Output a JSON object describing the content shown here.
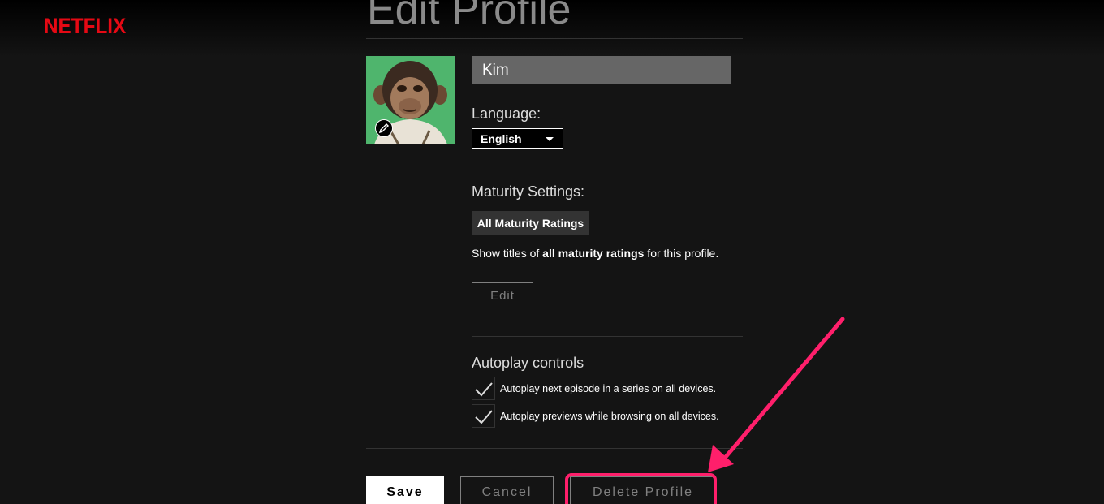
{
  "brand": {
    "logo_text": "NETFLIX",
    "logo_color": "#e50914"
  },
  "page": {
    "title": "Edit Profile"
  },
  "profile": {
    "name_value": "Kim",
    "avatar_icon": "chimpanzee-avatar",
    "edit_icon": "pencil-icon"
  },
  "language": {
    "label": "Language:",
    "selected": "English"
  },
  "maturity": {
    "label": "Maturity Settings:",
    "badge": "All Maturity Ratings",
    "desc_prefix": "Show titles of ",
    "desc_bold": "all maturity ratings",
    "desc_suffix": " for this profile.",
    "edit_label": "Edit"
  },
  "autoplay": {
    "label": "Autoplay controls",
    "options": [
      {
        "label": "Autoplay next episode in a series on all devices.",
        "checked": true
      },
      {
        "label": "Autoplay previews while browsing on all devices.",
        "checked": true
      }
    ]
  },
  "actions": {
    "save_label": "Save",
    "cancel_label": "Cancel",
    "delete_label": "Delete Profile"
  },
  "annotation": {
    "highlight_color": "#ff1f6b"
  }
}
